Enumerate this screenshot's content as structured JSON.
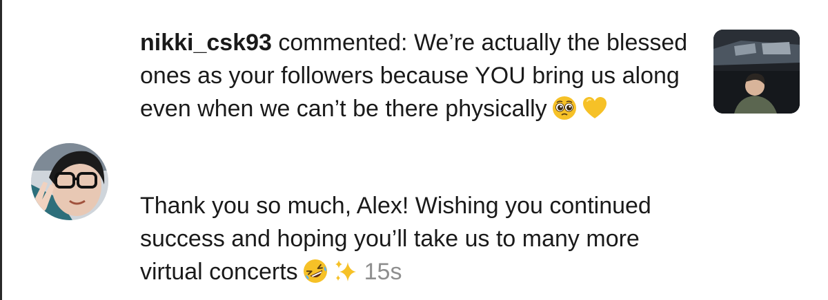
{
  "comment": {
    "username": "nikki_csk93",
    "action": "commented:",
    "text": "We’re actually the blessed ones as your followers because YOU bring us along even when we can’t be there physically",
    "emojis": [
      "pleading-face-emoji",
      "yellow-heart-emoji"
    ]
  },
  "reply": {
    "text": "Thank you so much, Alex! Wishing you continued success and hoping you’ll take us to many more virtual concerts",
    "emojis": [
      "rolling-laughing-face-emoji",
      "sparkles-emoji"
    ],
    "timestamp": "15s"
  },
  "colors": {
    "text": "#1a1a1a",
    "timestamp": "#8e8e8e",
    "emoji_yellow": "#f6c127"
  }
}
